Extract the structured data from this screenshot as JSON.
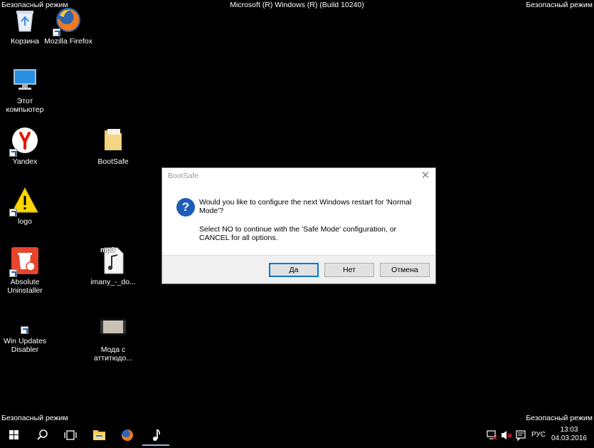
{
  "watermark": {
    "top_left": "Безопасный режим",
    "top_right": "Безопасный режим",
    "bottom_left": "Безопасный режим",
    "bottom_right": "Безопасный режим",
    "title": "Microsoft (R) Windows (R) (Build 10240)"
  },
  "desktop": {
    "icons": [
      {
        "name": "recycle-bin",
        "label": "Корзина"
      },
      {
        "name": "firefox",
        "label": "Mozilla Firefox"
      },
      {
        "name": "this-pc",
        "label": "Этот компьютер"
      },
      {
        "name": "yandex",
        "label": "Yandex"
      },
      {
        "name": "bootsafe",
        "label": "BootSafe"
      },
      {
        "name": "logo",
        "label": "logo"
      },
      {
        "name": "absolute-uninstaller",
        "label": "Absolute Uninstaller"
      },
      {
        "name": "imany-mp3",
        "label": "imany_-_do..."
      },
      {
        "name": "win-updates-disabler",
        "label": "Win Updates Disabler"
      },
      {
        "name": "moda-video",
        "label": "Мода с аттитюдо..."
      }
    ],
    "mp3_badge": "mp3"
  },
  "dialog": {
    "title": "BootSafe",
    "close_glyph": "✕",
    "icon_glyph": "?",
    "message_1": "Would you like to configure the next Windows restart for 'Normal Mode'?",
    "message_2": "Select NO to continue with the 'Safe Mode' configuration, or CANCEL for all options.",
    "buttons": {
      "yes": "Да",
      "no": "Нет",
      "cancel": "Отмена"
    }
  },
  "taskbar": {
    "language": "РУС",
    "time": "13:03",
    "date": "04.03.2016"
  },
  "colors": {
    "desktop_bg": "#000000",
    "dialog_accent": "#0078d7",
    "question_icon": "#1d5fb8"
  }
}
